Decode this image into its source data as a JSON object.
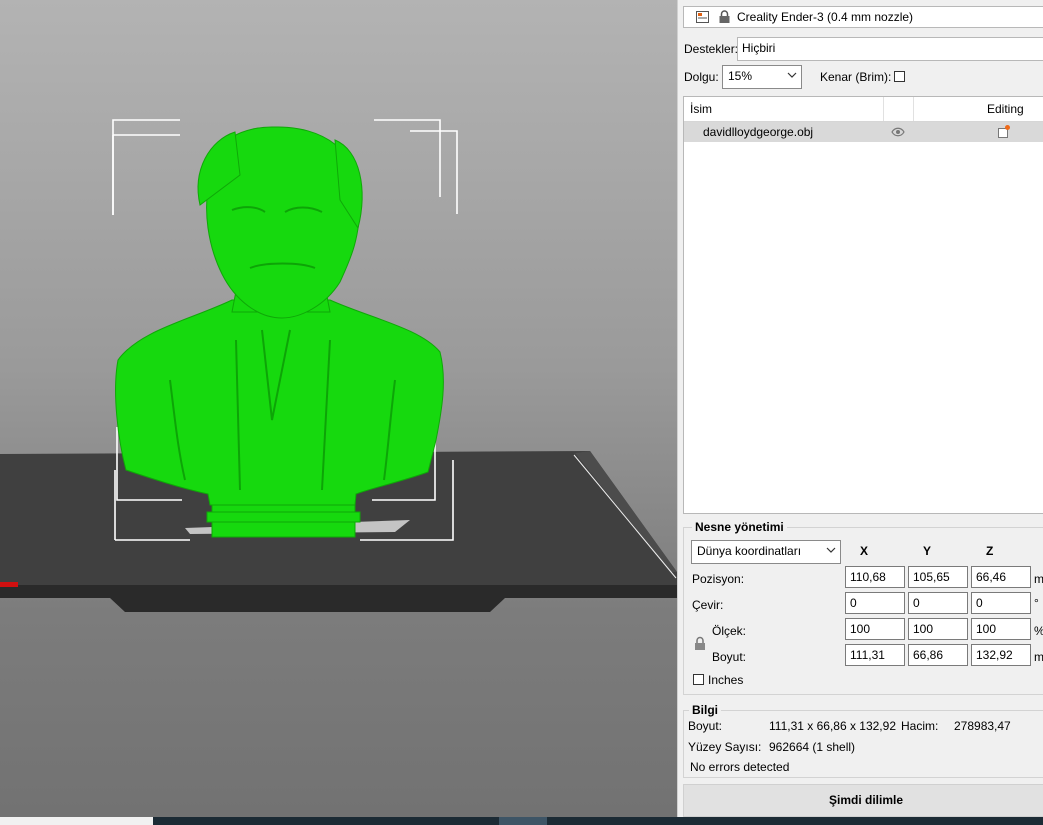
{
  "printer": {
    "name": "Creality Ender-3 (0.4 mm nozzle)"
  },
  "supports": {
    "label": "Destekler:",
    "value": "Hiçbiri"
  },
  "infill": {
    "label": "Dolgu:",
    "value": "15%",
    "brim_label": "Kenar (Brim):",
    "brim_checked": false
  },
  "object_list": {
    "columns": [
      "İsim",
      "",
      "Editing"
    ],
    "items": [
      {
        "name": "davidlloydgeorge.obj",
        "visible": true
      }
    ]
  },
  "object_manipulation": {
    "title": "Nesne yönetimi",
    "coord_system": "Dünya koordinatları",
    "axes": [
      "X",
      "Y",
      "Z"
    ],
    "rows": [
      {
        "label": "Pozisyon:",
        "values": [
          "110,68",
          "105,65",
          "66,46"
        ],
        "unit": "m"
      },
      {
        "label": "Çevir:",
        "values": [
          "0",
          "0",
          "0"
        ],
        "unit": "°"
      },
      {
        "label": "Ölçek:",
        "values": [
          "100",
          "100",
          "100"
        ],
        "unit": "%"
      },
      {
        "label": "Boyut:",
        "values": [
          "111,31",
          "66,86",
          "132,92"
        ],
        "unit": "m"
      }
    ],
    "inches_label": "Inches",
    "inches_checked": false
  },
  "info": {
    "title": "Bilgi",
    "size_label": "Boyut:",
    "size_value": "111,31 x 66,86 x 132,92",
    "volume_label": "Hacim:",
    "volume_value": "278983,47",
    "facets_label": "Yüzey Sayısı:",
    "facets_value": "962664 (1 shell)",
    "errors": "No errors detected"
  },
  "slice_button": "Şimdi dilimle",
  "colors": {
    "model": "#16d90e",
    "bed": "#3a3a3a",
    "panel": "#f0f0f0",
    "selected_row": "#d9d9d9"
  },
  "icons": [
    "printer-color-icon",
    "lock-icon",
    "eye-icon",
    "edit-object-icon",
    "chevron-down-icon"
  ]
}
